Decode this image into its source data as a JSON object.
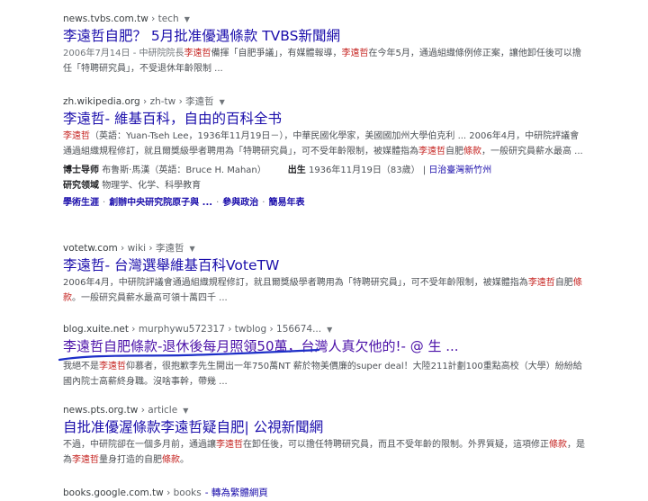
{
  "results": [
    {
      "cite_domain": "news.tvbs.com.tw",
      "cite_path": " › tech",
      "title": "李遠哲自肥？ 5月批准優遇條款 TVBS新聞網",
      "snippet": [
        {
          "t": "2006年7月14日 - 中研院院長",
          "c": "d"
        },
        {
          "t": "李遠哲",
          "c": "em"
        },
        {
          "t": "備揮「自肥爭議」，有媒體報導，",
          "c": ""
        },
        {
          "t": "李遠哲",
          "c": "em"
        },
        {
          "t": "在今年5月，通過組織條例修正案，讓他卸任後可以擔任「特聘研究員」，不受退休年齡限制 ...",
          "c": ""
        }
      ]
    },
    {
      "cite_domain": "zh.wikipedia.org",
      "cite_path": " › zh-tw › 李遠哲",
      "title": "李遠哲- 維基百科，自由的百科全书",
      "snippet": [
        {
          "t": "李遠哲",
          "c": "em"
        },
        {
          "t": "（英語：Yuan-Tseh Lee，1936年11月19日－），中華民國化學家，美國國加州大學伯克利 ... 2006年4月，中研院評議會通過組織規程修訂，就且爾獎級學者聘用為「特聘研究員」，可不受年齡限制，被媒體指為",
          "c": ""
        },
        {
          "t": "李遠哲",
          "c": "em"
        },
        {
          "t": "自肥",
          "c": ""
        },
        {
          "t": "條款",
          "c": "em"
        },
        {
          "t": "，一般研究員薪水最高 ...",
          "c": ""
        }
      ],
      "facts": {
        "advisor_label": "博士导师",
        "advisor_value": "布鲁斯·馬漢（英語：Bruce H. Mahan）",
        "born_label": "出生",
        "born_value": "1936年11月19日（83歲）",
        "born_place": "日治臺灣新竹州",
        "field_label": "研究领域",
        "field_value": "物理学、化学、科學教育"
      },
      "sitelinks": [
        "學術生涯",
        "創辦中央研究院原子與 ...",
        "參與政治",
        "簡易年表"
      ]
    },
    {
      "cite_domain": "votetw.com",
      "cite_path": " › wiki › 李遠哲",
      "title": "李遠哲- 台灣選舉維基百科VoteTW",
      "snippet": [
        {
          "t": "2006年4月，中研院評議會通過組織規程修訂，就且爾獎級學者聘用為「特聘研究員」，可不受年齡限制，被媒體指為",
          "c": ""
        },
        {
          "t": "李遠哲",
          "c": "em"
        },
        {
          "t": "自肥",
          "c": ""
        },
        {
          "t": "條款",
          "c": "em"
        },
        {
          "t": "。一般研究員薪水最高可領十萬四千 ...",
          "c": ""
        }
      ]
    },
    {
      "cite_domain": "blog.xuite.net",
      "cite_path": " › murphywu572317 › twblog › 156674...",
      "title": "李遠哲自肥條款-退休後每月照領50萬，台灣人真欠他的!- @ 生 ...",
      "snippet": [
        {
          "t": "我絕不是",
          "c": ""
        },
        {
          "t": "李遠哲",
          "c": "em"
        },
        {
          "t": "仰慕者，很抱歉李先生開出一年750萬NT 薪於物美價廉的super deal！大陸211計劃100重點高校（大學）紛紛給國內院士高薪終身職。沒啥事幹，帶幾 ...",
          "c": ""
        }
      ]
    },
    {
      "cite_domain": "news.pts.org.tw",
      "cite_path": " › article",
      "title": "自批准優渥條款李遠哲疑自肥| 公視新聞網",
      "snippet": [
        {
          "t": "不過，中研院卻在一個多月前，通過讓",
          "c": ""
        },
        {
          "t": "李遠哲",
          "c": "em"
        },
        {
          "t": "在卸任後，可以擔任特聘研究員，而且不受年齡的限制。外界質疑，這項修正",
          "c": ""
        },
        {
          "t": "條款",
          "c": "em"
        },
        {
          "t": "，是為",
          "c": ""
        },
        {
          "t": "李遠哲",
          "c": "em"
        },
        {
          "t": "量身打造的自肥",
          "c": ""
        },
        {
          "t": "條款",
          "c": "em"
        },
        {
          "t": "。",
          "c": ""
        }
      ]
    },
    {
      "cite_domain": "books.google.com.tw",
      "cite_path": " › books",
      "cite_translate": "- 轉為繁體網頁"
    }
  ]
}
